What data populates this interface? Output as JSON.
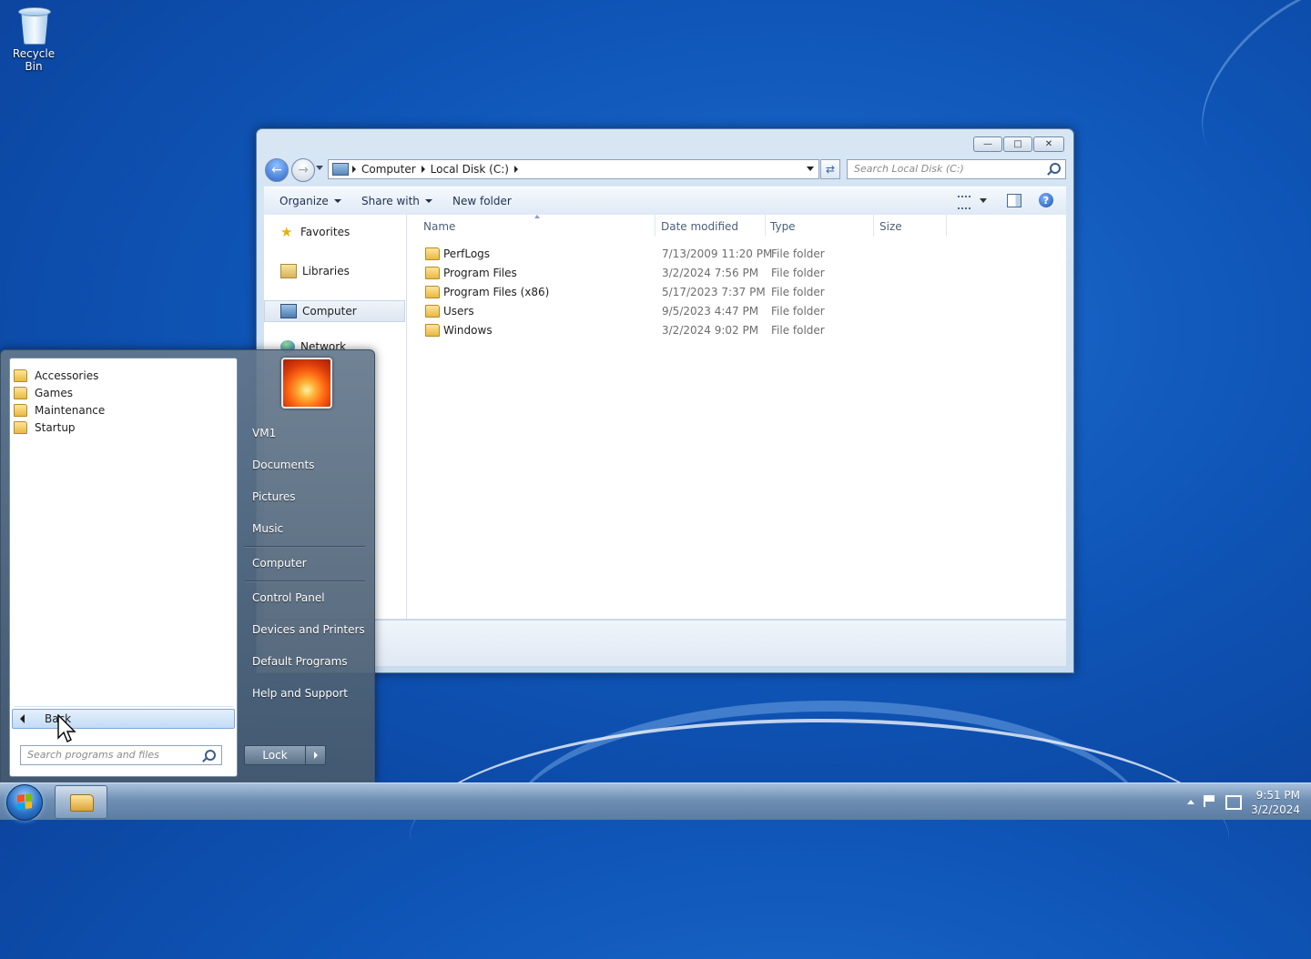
{
  "desktop": {
    "icons": [
      {
        "label": "Recycle Bin",
        "icon": "recycle-bin-icon"
      }
    ]
  },
  "explorer": {
    "breadcrumb": [
      "Computer",
      "Local Disk (C:)"
    ],
    "search_placeholder": "Search Local Disk (C:)",
    "toolbar": {
      "organize": "Organize",
      "share_with": "Share with",
      "new_folder": "New folder"
    },
    "nav": {
      "favorites": "Favorites",
      "libraries": "Libraries",
      "computer": "Computer",
      "network": "Network"
    },
    "columns": {
      "name": "Name",
      "date_modified": "Date modified",
      "type": "Type",
      "size": "Size"
    },
    "files": [
      {
        "name": "PerfLogs",
        "date": "7/13/2009 11:20 PM",
        "type": "File folder"
      },
      {
        "name": "Program Files",
        "date": "3/2/2024 7:56 PM",
        "type": "File folder"
      },
      {
        "name": "Program Files (x86)",
        "date": "5/17/2023 7:37 PM",
        "type": "File folder"
      },
      {
        "name": "Users",
        "date": "9/5/2023 4:47 PM",
        "type": "File folder"
      },
      {
        "name": "Windows",
        "date": "3/2/2024 9:02 PM",
        "type": "File folder"
      }
    ]
  },
  "start_menu": {
    "programs": [
      "Accessories",
      "Games",
      "Maintenance",
      "Startup"
    ],
    "back_label": "Back",
    "search_placeholder": "Search programs and files",
    "right_items": {
      "user": "VM1",
      "documents": "Documents",
      "pictures": "Pictures",
      "music": "Music",
      "computer": "Computer",
      "control_panel": "Control Panel",
      "devices_printers": "Devices and Printers",
      "default_programs": "Default Programs",
      "help_support": "Help and Support"
    },
    "lock_label": "Lock"
  },
  "taskbar": {
    "time": "9:51 PM",
    "date": "3/2/2024"
  }
}
